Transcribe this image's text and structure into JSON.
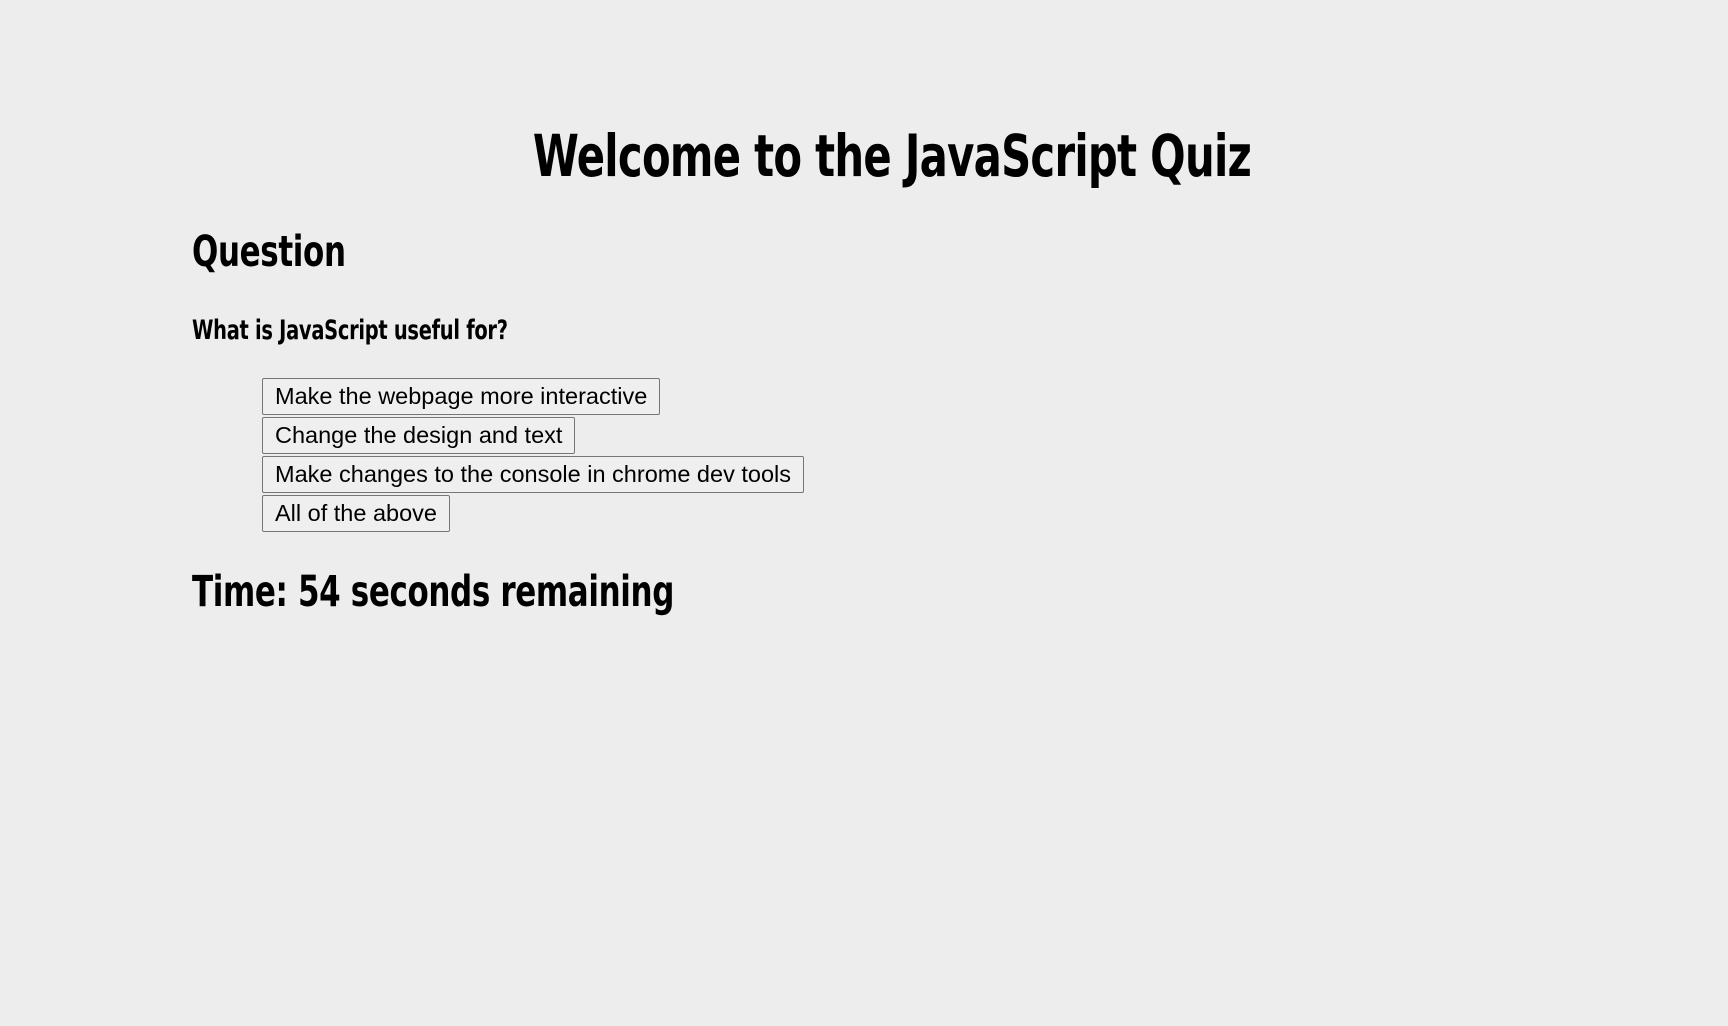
{
  "header": {
    "title": "Welcome to the JavaScript Quiz"
  },
  "question": {
    "heading": "Question",
    "text": "What is JavaScript useful for?",
    "choices": [
      "Make the webpage more interactive",
      "Change the design and text",
      "Make changes to the console in chrome dev tools",
      "All of the above"
    ]
  },
  "timer": {
    "label": "Time:",
    "seconds": 54,
    "text": "Time: 54 seconds remaining"
  },
  "colors": {
    "background": "#ededed",
    "text": "#000000",
    "button_background": "#efefef",
    "button_border": "#767676"
  }
}
